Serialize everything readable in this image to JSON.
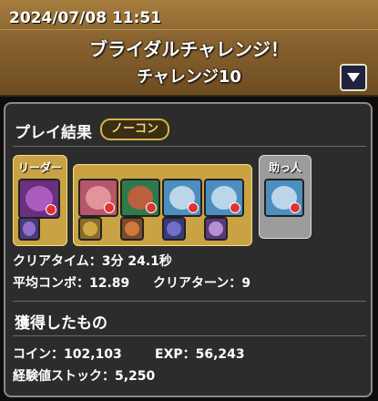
{
  "header": {
    "timestamp": "2024/07/08 11:51",
    "dungeon_name": "ブライダルチャレンジ！",
    "floor_name": "チャレンジ10"
  },
  "result": {
    "section_title": "プレイ結果",
    "badge": "ノーコン",
    "leader_label": "リーダー",
    "helper_label": "助っ人",
    "clear_time_label": "クリアタイム：",
    "clear_time_value": "3分 24.1秒",
    "avg_combo_label": "平均コンボ：",
    "avg_combo_value": "12.89",
    "clear_turn_label": "クリアターン：",
    "clear_turn_value": "9"
  },
  "rewards": {
    "section_title": "獲得したもの",
    "coin_label": "コイン：",
    "coin_value": "102,103",
    "exp_label": "EXP：",
    "exp_value": "56,243",
    "exp_stock_label": "経験値ストック：",
    "exp_stock_value": "5,250"
  },
  "colors": {
    "gold": "#c9a343",
    "header": "#8a6430",
    "panel": "#2c2c2c"
  }
}
